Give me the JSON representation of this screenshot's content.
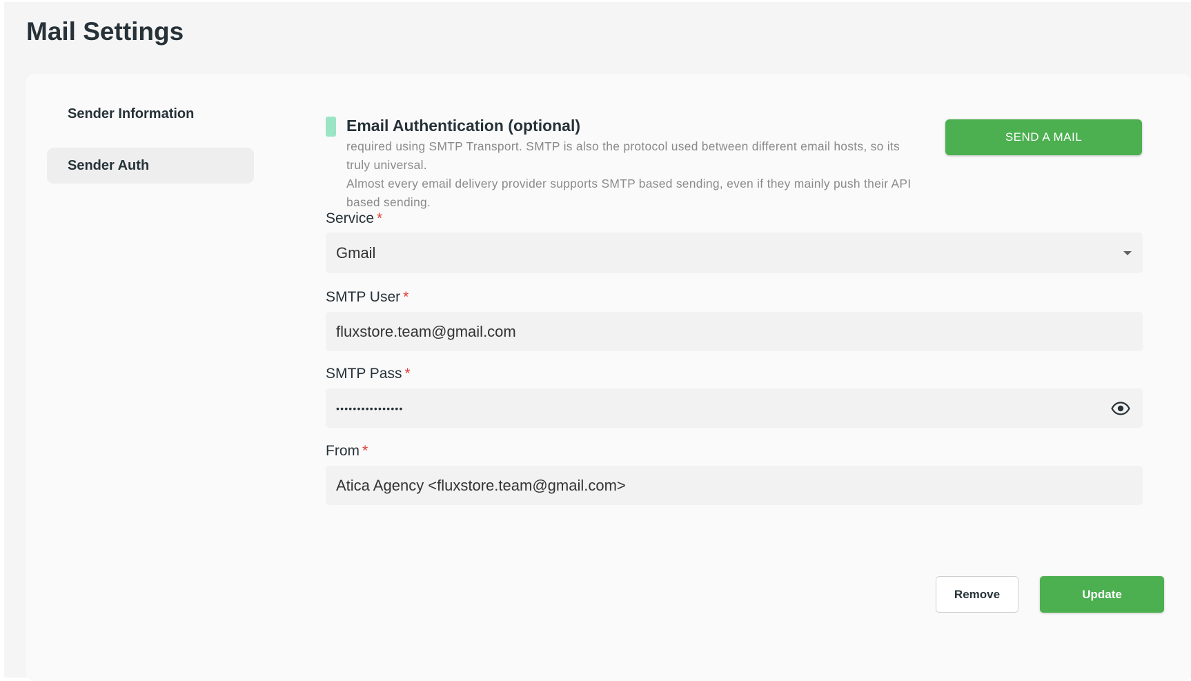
{
  "page": {
    "title": "Mail Settings"
  },
  "sidebar": {
    "items": [
      {
        "label": "Sender Information",
        "active": false
      },
      {
        "label": "Sender Auth",
        "active": true
      }
    ]
  },
  "auth_section": {
    "title": "Email Authentication (optional)",
    "description_line1": "required using SMTP Transport. SMTP is also the protocol used between different email hosts, so its truly universal.",
    "description_line2": "Almost every email delivery provider supports SMTP based sending, even if they mainly push their API based sending.",
    "send_button_label": "SEND A MAIL"
  },
  "form": {
    "service": {
      "label": "Service",
      "required_mark": "*",
      "value": "Gmail"
    },
    "smtp_user": {
      "label": "SMTP User",
      "required_mark": "*",
      "value": "fluxstore.team@gmail.com"
    },
    "smtp_pass": {
      "label": "SMTP Pass",
      "required_mark": "*",
      "value": "••••••••••••••••"
    },
    "from": {
      "label": "From",
      "required_mark": "*",
      "value": "Atica Agency <fluxstore.team@gmail.com>"
    }
  },
  "actions": {
    "remove_label": "Remove",
    "update_label": "Update"
  },
  "colors": {
    "accent": "#4caf50",
    "marker": "#9be4c4",
    "required": "#e53935"
  },
  "icons": {
    "dropdown": "caret-down-icon",
    "password_toggle": "eye-icon"
  }
}
